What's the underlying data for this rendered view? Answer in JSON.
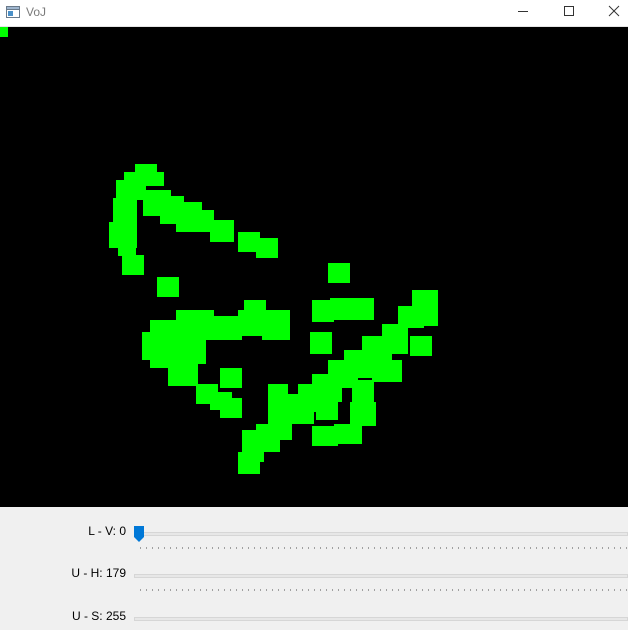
{
  "window": {
    "title": "VoJ",
    "app_icon": "window-app-icon",
    "controls": [
      "minimize-icon",
      "maximize-icon",
      "close-icon"
    ]
  },
  "image_view": {
    "background": "#000000",
    "mask_color": "#00ff00"
  },
  "trackbars": [
    {
      "label": "L - V: 0",
      "value": 0,
      "max": 255
    },
    {
      "label": "U - H: 179",
      "value": 179,
      "max": 179
    },
    {
      "label": "U - S: 255",
      "value": 255,
      "max": 255
    }
  ],
  "colors": {
    "thumb": "#0078d7",
    "window_bg": "#f0f0f0"
  }
}
